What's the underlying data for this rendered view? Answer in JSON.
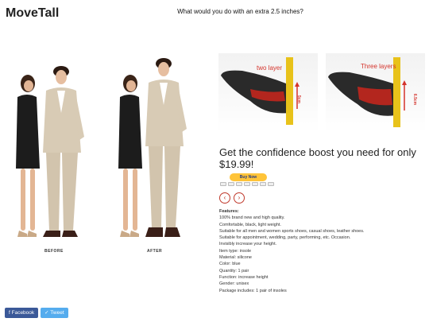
{
  "brand": "MoveTall",
  "tagline": "What would you do with an extra 2.5 inches?",
  "before_after": {
    "before_label": "BEFORE",
    "after_label": "AFTER"
  },
  "insoles": [
    {
      "label": "two layer",
      "height": "5cm"
    },
    {
      "label": "Three layers",
      "height": "6.5cm"
    }
  ],
  "headline": "Get the confidence boost you need for only $19.99!",
  "buy_button": "Buy Now",
  "features": {
    "title": "Features:",
    "lines": [
      "100% brand new and high quality.",
      "Comfortable, black, light weight.",
      "Suitable for all men and women sports shoes, casual shoes, leather shoes.",
      "Suitable for appointment, wedding, party, performing, etc. Occasion.",
      "Invisibly increase your height.",
      "Item type: insole",
      "Material: silicone",
      "Color: blue",
      "Quantity: 1 pair",
      "Function: increase height",
      "Gender: unisex",
      "Package includes: 1 pair of insoles"
    ]
  },
  "share": {
    "facebook": "f Facebook",
    "twitter": "✓ Tweet"
  },
  "colors": {
    "paypal_yellow": "#ffc439",
    "nav_red": "#c0392b",
    "facebook_blue": "#3b5998",
    "twitter_blue": "#55acee"
  }
}
